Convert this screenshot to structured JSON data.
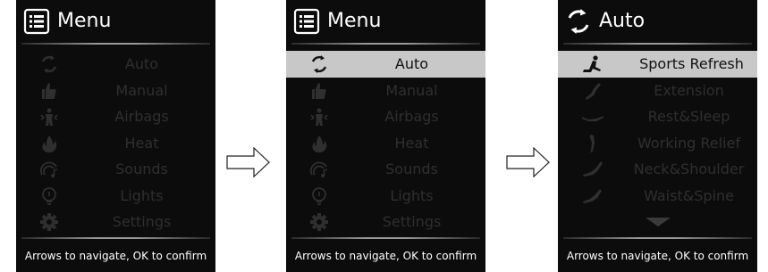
{
  "screens": [
    {
      "title": "Menu",
      "title_icon": "menu-list-icon",
      "footer": "Arrows to navigate, OK to confirm",
      "items": [
        {
          "icon": "auto-cycle-icon",
          "label": "Auto",
          "selected": false
        },
        {
          "icon": "thumb-massage-icon",
          "label": "Manual",
          "selected": false
        },
        {
          "icon": "airbags-body-icon",
          "label": "Airbags",
          "selected": false
        },
        {
          "icon": "heat-flame-icon",
          "label": "Heat",
          "selected": false
        },
        {
          "icon": "sounds-music-icon",
          "label": "Sounds",
          "selected": false
        },
        {
          "icon": "lights-bulb-icon",
          "label": "Lights",
          "selected": false
        },
        {
          "icon": "settings-gear-icon",
          "label": "Settings",
          "selected": false
        }
      ]
    },
    {
      "title": "Menu",
      "title_icon": "menu-list-icon",
      "footer": "Arrows to navigate, OK to confirm",
      "items": [
        {
          "icon": "auto-cycle-icon",
          "label": "Auto",
          "selected": true
        },
        {
          "icon": "thumb-massage-icon",
          "label": "Manual",
          "selected": false
        },
        {
          "icon": "airbags-body-icon",
          "label": "Airbags",
          "selected": false
        },
        {
          "icon": "heat-flame-icon",
          "label": "Heat",
          "selected": false
        },
        {
          "icon": "sounds-music-icon",
          "label": "Sounds",
          "selected": false
        },
        {
          "icon": "lights-bulb-icon",
          "label": "Lights",
          "selected": false
        },
        {
          "icon": "settings-gear-icon",
          "label": "Settings",
          "selected": false
        }
      ]
    },
    {
      "title": "Auto",
      "title_icon": "auto-cycle-icon",
      "footer": "Arrows to navigate, OK to confirm",
      "more_icon": "more-down-arrow-icon",
      "items": [
        {
          "icon": "sports-refresh-posture-icon",
          "label": "Sports Refresh",
          "selected": true
        },
        {
          "icon": "extension-posture-icon",
          "label": "Extension",
          "selected": false
        },
        {
          "icon": "rest-sleep-posture-icon",
          "label": "Rest&Sleep",
          "selected": false
        },
        {
          "icon": "working-relief-posture-icon",
          "label": "Working Relief",
          "selected": false
        },
        {
          "icon": "neck-shoulder-posture-icon",
          "label": "Neck&Shoulder",
          "selected": false
        },
        {
          "icon": "waist-spine-posture-icon",
          "label": "Waist&Spine",
          "selected": false
        }
      ]
    }
  ],
  "colors": {
    "screen_bg": "#0c0c0c",
    "selected_bg": "#c8c8c8",
    "dim_text": "#2f2f2f",
    "bright_text": "#ffffff"
  }
}
